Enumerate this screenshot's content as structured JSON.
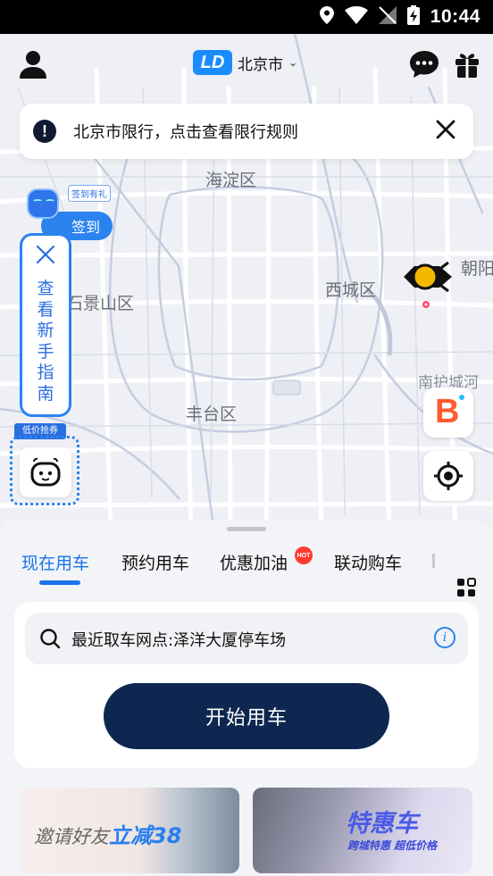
{
  "status_bar": {
    "time": "10:44"
  },
  "header": {
    "city": "北京市"
  },
  "notice": {
    "text": "北京市限行，点击查看限行规则"
  },
  "map": {
    "labels": {
      "haidian": "海淀区",
      "xicheng": "西城区",
      "chaoyang": "朝阳",
      "shijingshan": "石景山区",
      "fengtai": "丰台区",
      "nanhucheng": "南护城河"
    }
  },
  "checkin": {
    "tag": "签到有礼",
    "label": "签到"
  },
  "guide": {
    "label": "查看新手指南"
  },
  "coupon_tag": "低价抢券",
  "tabs": [
    {
      "label": "现在用车",
      "active": true
    },
    {
      "label": "预约用车"
    },
    {
      "label": "优惠加油"
    },
    {
      "label": "联动购车"
    }
  ],
  "hot_badge": "HOT",
  "search": {
    "text": "最近取车网点:泽洋大厦停车场"
  },
  "start_button": "开始用车",
  "promos": {
    "left": {
      "prefix": "邀请好友",
      "highlight": "立减38"
    },
    "right": {
      "title": "特惠车",
      "subtitle": "跨城特惠 超低价格"
    }
  },
  "colors": {
    "accent": "#1a74e8",
    "primary_button": "#0e2750",
    "hot": "#ff3b30"
  }
}
